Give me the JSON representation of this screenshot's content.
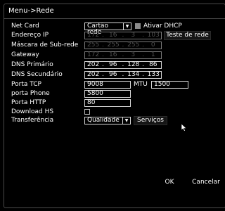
{
  "title": "Menu->Rede",
  "labels": {
    "net_card": "Net Card",
    "ip": "Endereço IP",
    "mask": "Máscara de Sub-rede",
    "gateway": "Gateway",
    "dns1": "DNS Primário",
    "dns2": "DNS Secundário",
    "tcp": "Porta TCP",
    "phone": "porta Phone",
    "http": "Porta HTTP",
    "hs": "Download HS",
    "transfer": "Transferência",
    "mtu": "MTU",
    "dhcp": "Ativar DHCP"
  },
  "fields": {
    "net_card": "Cartão rede",
    "ip": [
      "172",
      "16",
      "3",
      "103"
    ],
    "mask": [
      "255",
      "255",
      "255",
      "0"
    ],
    "gateway": [
      "172",
      "16",
      "3",
      "1"
    ],
    "dns1": [
      "202",
      "96",
      "128",
      "86"
    ],
    "dns2": [
      "202",
      "96",
      "134",
      "133"
    ],
    "tcp": "9008",
    "mtu": "1500",
    "phone": "5800",
    "http": "80",
    "transfer": "Qualidade"
  },
  "buttons": {
    "test": "Teste de rede",
    "services": "Serviços",
    "ok": "OK",
    "cancel": "Cancelar"
  },
  "states": {
    "dhcp_checked": true,
    "download_hs_checked": false
  }
}
